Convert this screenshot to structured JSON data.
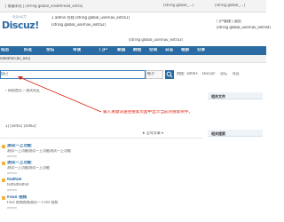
{
  "top_strip": {
    "left_text": "| 收藏本站 | [string global_viewthread_extra]",
    "right_items": [
      "[string global_...]",
      "[string global_...]"
    ]
  },
  "header": {
    "logo_cn": "社区动力",
    "logo_mark": "Discuz!",
    "user_line1": "1 admin 在线 [string global_usernav_extra1]",
    "user_line2": "[string global_usernav_extra2]",
    "user_line3": "[string global_usernav_extra3]",
    "right_line1": "门户管理 | 退出",
    "right_line2": "[string global_usernav_extra4]"
  },
  "nav": {
    "items": [
      "站点",
      "好友",
      "论坛",
      "导读",
      "门户",
      "家园",
      "群组",
      "空间",
      "日志",
      "相册",
      "分享"
    ]
  },
  "subnav": {
    "text": "ndedmin.bc_nsv]"
  },
  "search": {
    "value": "自己",
    "type_label": "帖子",
    "hot_label": "热搜:",
    "hot_items": [
      "3000+",
      "Discuz!",
      "论坛",
      "社区"
    ]
  },
  "breadcrumb": {
    "text": "› 网站首页 › 测试社区"
  },
  "annotation": {
    "text": "输入关键词送往搜索页面中显示当前的搜索条件。"
  },
  "sidebar": {
    "titles": [
      "相关文件",
      "相关搜索"
    ]
  },
  "threads": {
    "header": "1] [svfe1] [svfe2]",
    "sort_label": "★ 全年文章 ▾",
    "rows": [
      {
        "title": "测试一上功能",
        "sub": "测试一上功能测试一上功能测试一上功能",
        "meta": "admin"
      },
      {
        "title": "测试一上功能",
        "sub": "测试一上功能测试一上功能",
        "meta": "admin"
      },
      {
        "title": "fsdfsd",
        "sub": "fsdfsdfsdfsd",
        "meta": "admin"
      },
      {
        "title": "Fsss 视频",
        "sub": "Fsss 视频视频测试一下css 视频",
        "meta": "admin"
      }
    ]
  },
  "colors": {
    "nav_bg": "#2b6ba4",
    "annotation": "#d9230f",
    "link": "#2b6ba4"
  }
}
